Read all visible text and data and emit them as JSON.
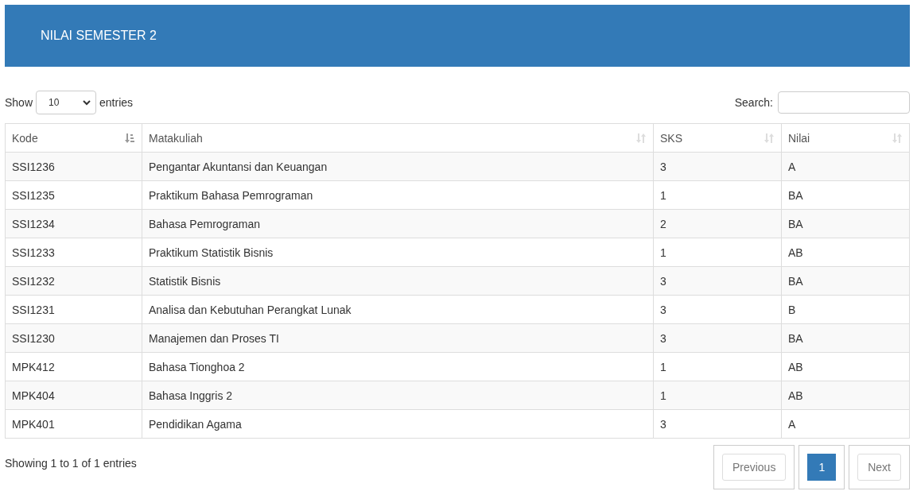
{
  "panel": {
    "title": "NILAI SEMESTER 2"
  },
  "length_menu": {
    "prefix": "Show",
    "value": "10",
    "suffix": "entries"
  },
  "search": {
    "label": "Search:"
  },
  "table": {
    "columns": [
      {
        "label": "Kode",
        "sorted": true
      },
      {
        "label": "Matakuliah",
        "sorted": false
      },
      {
        "label": "SKS",
        "sorted": false
      },
      {
        "label": "Nilai",
        "sorted": false
      }
    ],
    "rows": [
      [
        "SSI1236",
        "Pengantar Akuntansi dan Keuangan",
        "3",
        "A"
      ],
      [
        "SSI1235",
        "Praktikum Bahasa Pemrograman",
        "1",
        "BA"
      ],
      [
        "SSI1234",
        "Bahasa Pemrograman",
        "2",
        "BA"
      ],
      [
        "SSI1233",
        "Praktikum Statistik Bisnis",
        "1",
        "AB"
      ],
      [
        "SSI1232",
        "Statistik Bisnis",
        "3",
        "BA"
      ],
      [
        "SSI1231",
        "Analisa dan Kebutuhan Perangkat Lunak",
        "3",
        "B"
      ],
      [
        "SSI1230",
        "Manajemen dan Proses TI",
        "3",
        "BA"
      ],
      [
        "MPK412",
        "Bahasa Tionghoa 2",
        "1",
        "AB"
      ],
      [
        "MPK404",
        "Bahasa Inggris 2",
        "1",
        "AB"
      ],
      [
        "MPK401",
        "Pendidikan Agama",
        "3",
        "A"
      ]
    ]
  },
  "info": "Showing 1 to 1 of 1 entries",
  "pagination": {
    "previous": {
      "label": "Previous",
      "disabled": true
    },
    "pages": [
      {
        "label": "1",
        "selected": true
      }
    ],
    "next": {
      "label": "Next",
      "disabled": true
    }
  }
}
